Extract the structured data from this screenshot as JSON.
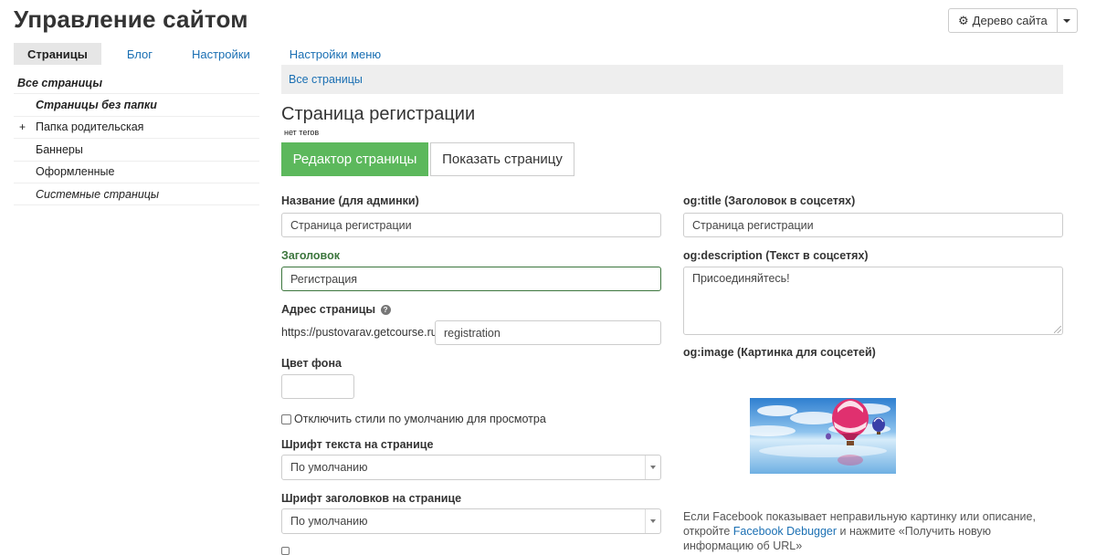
{
  "header": {
    "title": "Управление сайтом",
    "tree_button_label": "Дерево сайта"
  },
  "tabs": [
    {
      "label": "Страницы",
      "active": true
    },
    {
      "label": "Блог"
    },
    {
      "label": "Настройки"
    },
    {
      "label": "Настройки меню"
    }
  ],
  "sidebar": {
    "items": [
      {
        "label": "Все страницы"
      },
      {
        "label": "Страницы без папки"
      },
      {
        "label": "Папка родительская",
        "expander": "+"
      },
      {
        "label": "Баннеры"
      },
      {
        "label": "Оформленные"
      },
      {
        "label": "Системные страницы"
      }
    ]
  },
  "breadcrumb": "Все страницы",
  "page": {
    "title": "Страница регистрации",
    "tags_note": "нет тегов",
    "edit_button": "Редактор страницы",
    "show_button": "Показать страницу"
  },
  "form": {
    "name_label": "Название (для админки)",
    "name_value": "Страница регистрации",
    "heading_label": "Заголовок",
    "heading_value": "Регистрация",
    "url_label": "Адрес страницы",
    "help_glyph": "?",
    "url_prefix": "https://pustovarav.getcourse.ru/",
    "url_value": "registration",
    "bg_color_label": "Цвет фона",
    "bg_color_value": "",
    "disable_styles_label": "Отключить стили по умолчанию для просмотра",
    "font_text_label": "Шрифт текста на странице",
    "font_text_value": "По умолчанию",
    "font_headings_label": "Шрифт заголовков на странице",
    "font_headings_value": "По умолчанию"
  },
  "og": {
    "title_label": "og:title (Заголовок в соцсетях)",
    "title_value": "Страница регистрации",
    "description_label": "og:description (Текст в соцсетях)",
    "description_value": "Присоединяйтесь!",
    "image_label": "og:image (Картинка для соцсетей)",
    "fb_note_before": "Если Facebook показывает неправильную картинку или описание, откройте",
    "fb_link": "Facebook Debugger",
    "fb_note_after": "и нажмите «Получить новую информацию об URL»"
  },
  "colors": {
    "accent_green": "#5cb85c",
    "link_blue": "#1a6fb3",
    "valid_green": "#3c763d"
  },
  "icons": {
    "tree_button": "gear-icon",
    "tree_caret": "chevron-down-icon",
    "help": "question-circle-icon"
  }
}
